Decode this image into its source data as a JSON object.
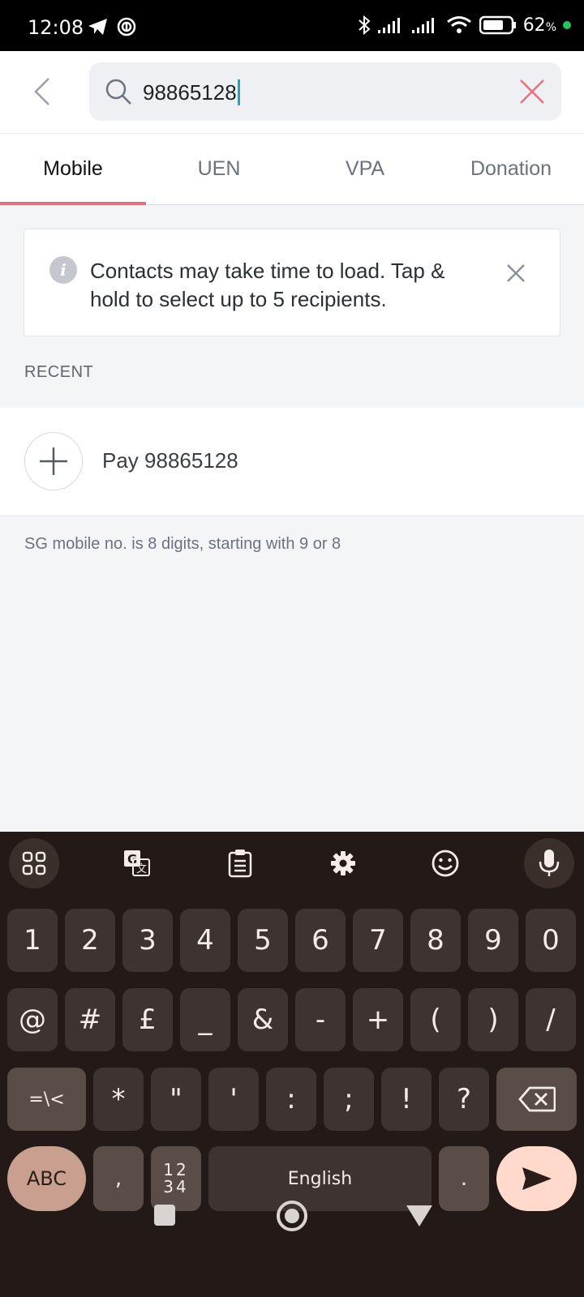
{
  "status_bar": {
    "time": "12:08",
    "battery_percent": "62",
    "battery_unit": "%"
  },
  "search": {
    "value": "98865128"
  },
  "tabs": [
    {
      "label": "Mobile",
      "active": true
    },
    {
      "label": "UEN",
      "active": false
    },
    {
      "label": "VPA",
      "active": false
    },
    {
      "label": "Donation",
      "active": false
    }
  ],
  "info_banner": {
    "text": "Contacts may take time to load. Tap & hold to select up to 5 recipients."
  },
  "recent": {
    "section_label": "RECENT",
    "pay_label": "Pay 98865128"
  },
  "hint": "SG mobile no. is 8 digits, starting with 9 or 8",
  "keyboard": {
    "row1": [
      "1",
      "2",
      "3",
      "4",
      "5",
      "6",
      "7",
      "8",
      "9",
      "0"
    ],
    "row2": [
      "@",
      "#",
      "£",
      "_",
      "&",
      "-",
      "+",
      "(",
      ")",
      "/"
    ],
    "row3": [
      "=\\<",
      "*",
      "\"",
      "'",
      ":",
      ";",
      "!",
      "?"
    ],
    "abc_label": "ABC",
    "comma": ",",
    "numpad_top": "12",
    "numpad_bottom": "34",
    "space_label": "English",
    "period": "."
  },
  "colors": {
    "accent_tab": "#e8707d",
    "caret": "#1aa9b8",
    "clear_x": "#e8707d",
    "keyboard_bg": "#231a17"
  }
}
